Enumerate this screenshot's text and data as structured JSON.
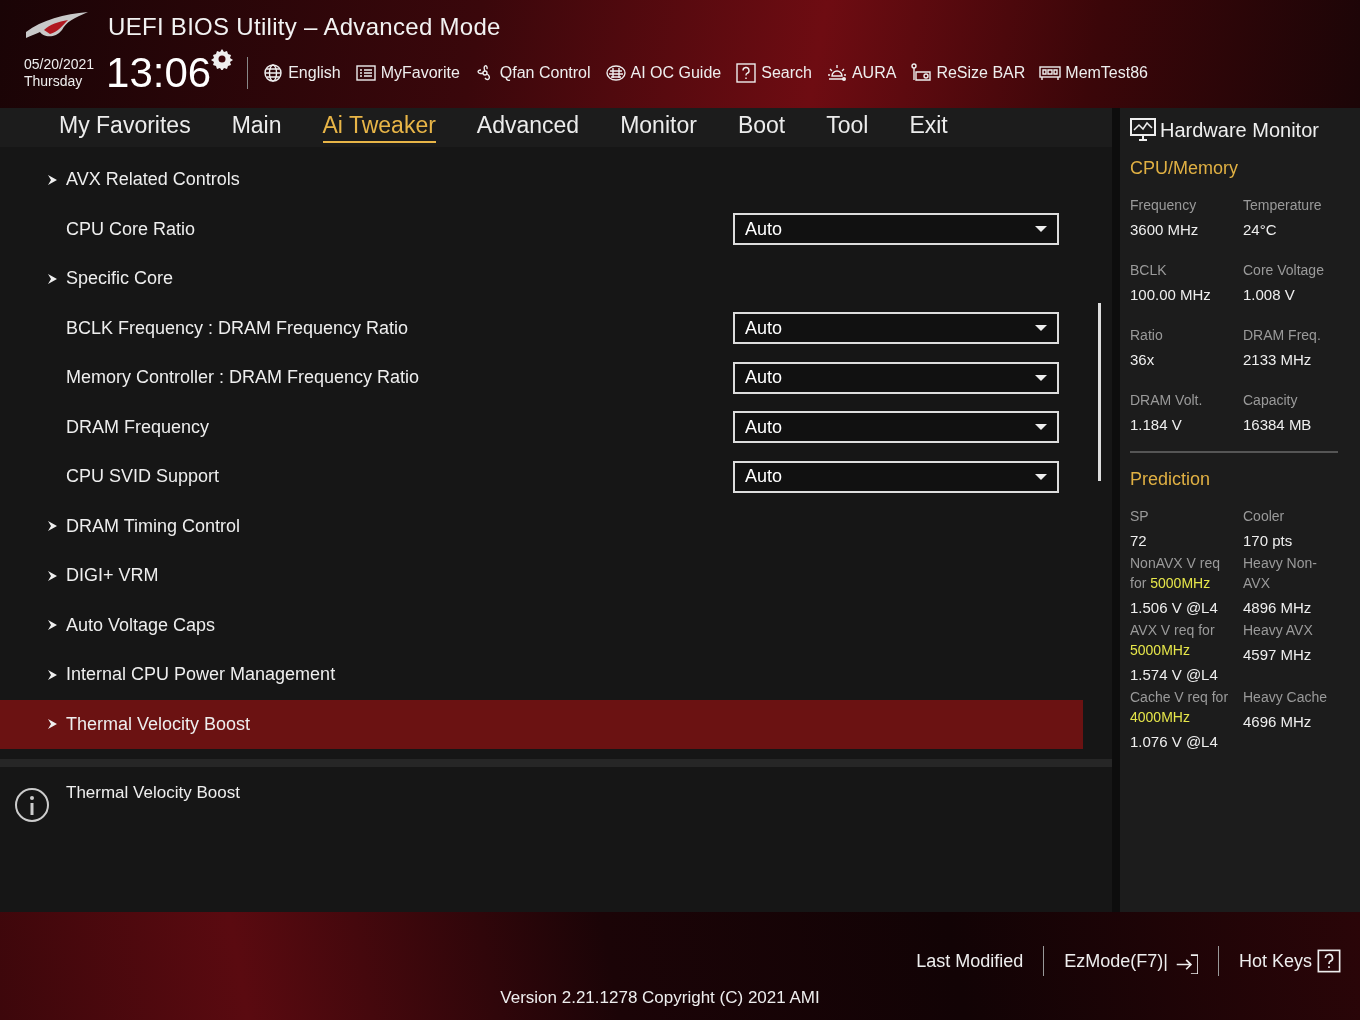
{
  "header": {
    "title": "UEFI BIOS Utility – Advanced Mode",
    "date": "05/20/2021",
    "day": "Thursday",
    "time": "13:06",
    "toolbar": [
      {
        "label": "English"
      },
      {
        "label": "MyFavorite"
      },
      {
        "label": "Qfan Control"
      },
      {
        "label": "AI OC Guide"
      },
      {
        "label": "Search"
      },
      {
        "label": "AURA"
      },
      {
        "label": "ReSize BAR"
      },
      {
        "label": "MemTest86"
      }
    ]
  },
  "tabs": [
    {
      "label": "My Favorites",
      "selected": false
    },
    {
      "label": "Main",
      "selected": false
    },
    {
      "label": "Ai Tweaker",
      "selected": true
    },
    {
      "label": "Advanced",
      "selected": false
    },
    {
      "label": "Monitor",
      "selected": false
    },
    {
      "label": "Boot",
      "selected": false
    },
    {
      "label": "Tool",
      "selected": false
    },
    {
      "label": "Exit",
      "selected": false
    }
  ],
  "settings": [
    {
      "kind": "submenu",
      "label": "AVX Related Controls",
      "selected": false
    },
    {
      "kind": "dropdown",
      "label": "CPU Core Ratio",
      "value": "Auto",
      "selected": false
    },
    {
      "kind": "submenu",
      "label": "Specific Core",
      "selected": false
    },
    {
      "kind": "dropdown",
      "label": "BCLK Frequency : DRAM Frequency Ratio",
      "value": "Auto",
      "selected": false
    },
    {
      "kind": "dropdown",
      "label": "Memory Controller : DRAM Frequency Ratio",
      "value": "Auto",
      "selected": false
    },
    {
      "kind": "dropdown",
      "label": "DRAM Frequency",
      "value": "Auto",
      "selected": false
    },
    {
      "kind": "dropdown",
      "label": "CPU SVID Support",
      "value": "Auto",
      "selected": false
    },
    {
      "kind": "submenu",
      "label": "DRAM Timing Control",
      "selected": false
    },
    {
      "kind": "submenu",
      "label": "DIGI+ VRM",
      "selected": false
    },
    {
      "kind": "submenu",
      "label": "Auto Voltage Caps",
      "selected": false
    },
    {
      "kind": "submenu",
      "label": "Internal CPU Power Management",
      "selected": false
    },
    {
      "kind": "submenu",
      "label": "Thermal Velocity Boost",
      "selected": true
    }
  ],
  "help": {
    "text": "Thermal Velocity Boost"
  },
  "hardware_monitor": {
    "title": "Hardware Monitor",
    "sections": [
      {
        "title": "CPU/Memory",
        "cells": [
          {
            "label": "Frequency",
            "value": "3600 MHz"
          },
          {
            "label": "Temperature",
            "value": "24°C"
          },
          {
            "label": "BCLK",
            "value": "100.00 MHz"
          },
          {
            "label": "Core Voltage",
            "value": "1.008 V"
          },
          {
            "label": "Ratio",
            "value": "36x"
          },
          {
            "label": "DRAM Freq.",
            "value": "2133 MHz"
          },
          {
            "label": "DRAM Volt.",
            "value": "1.184 V"
          },
          {
            "label": "Capacity",
            "value": "16384 MB"
          }
        ]
      },
      {
        "title": "Prediction",
        "cells": [
          {
            "label": "SP",
            "value": "72"
          },
          {
            "label": "Cooler",
            "value": "170 pts"
          },
          {
            "label": "NonAVX V req for **5000MHz**",
            "value": "1.506 V @L4"
          },
          {
            "label": "Heavy Non-AVX",
            "value": "4896 MHz"
          },
          {
            "label": "AVX V req for **5000MHz**",
            "value": "1.574 V @L4"
          },
          {
            "label": "Heavy AVX",
            "value": "4597 MHz"
          },
          {
            "label": "Cache V req for **4000MHz**",
            "value": "1.076 V @L4"
          },
          {
            "label": "Heavy Cache",
            "value": "4696 MHz"
          }
        ]
      }
    ]
  },
  "footer": {
    "actions": [
      {
        "label": "Last Modified"
      },
      {
        "label": "EzMode(F7)|"
      },
      {
        "label": "Hot Keys"
      }
    ],
    "version": "Version 2.21.1278 Copyright (C) 2021 AMI"
  }
}
